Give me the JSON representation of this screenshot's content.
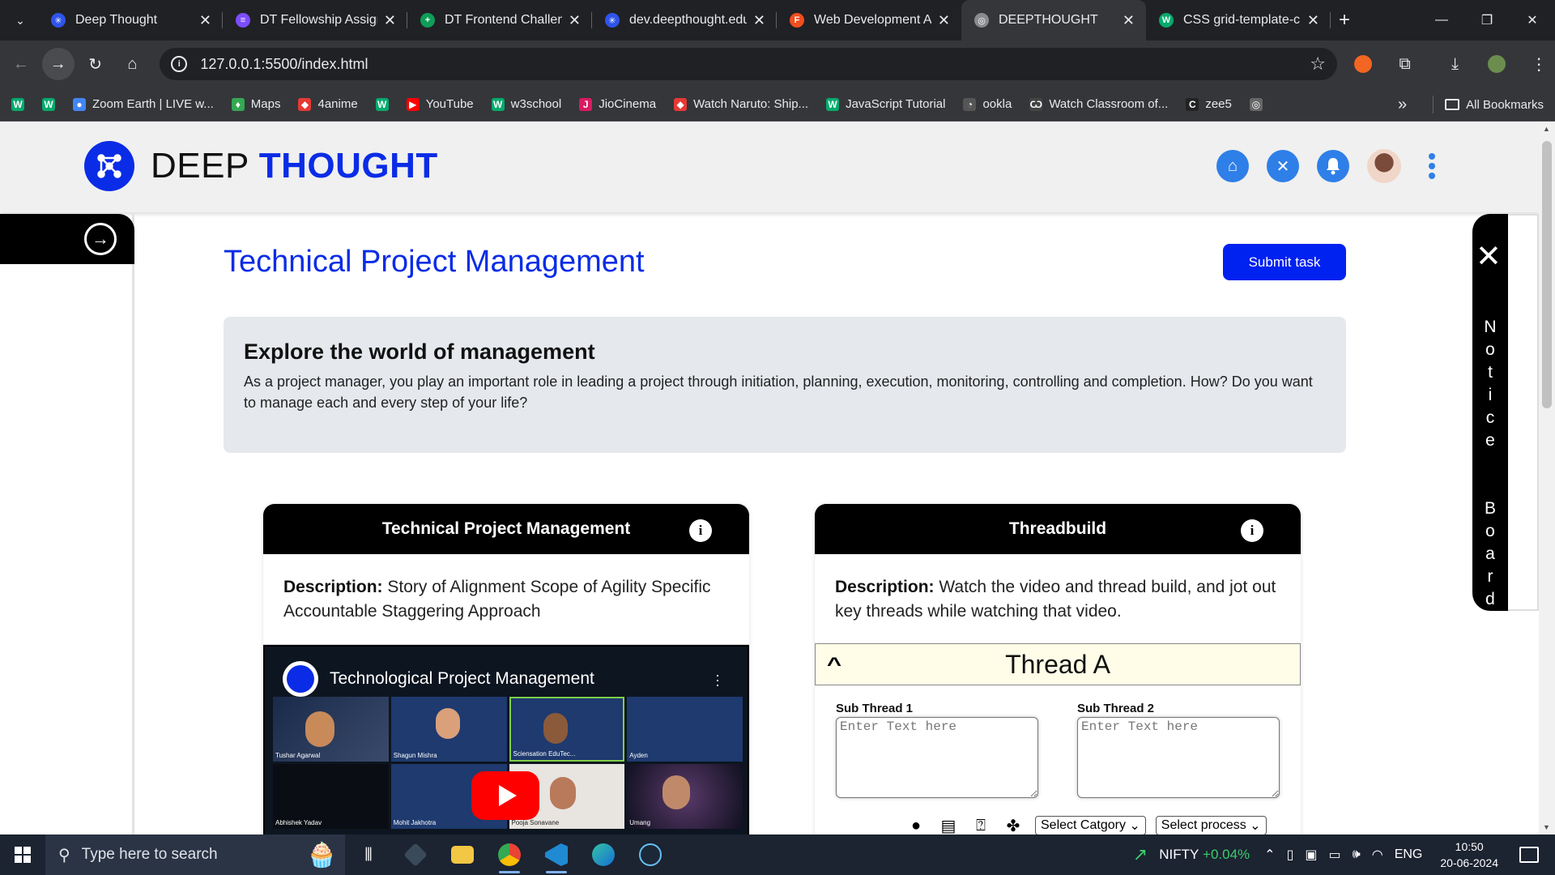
{
  "browser": {
    "tabs": [
      {
        "title": "Deep Thought",
        "color": "#2f54eb",
        "glyph": "✳"
      },
      {
        "title": "DT Fellowship Assign",
        "color": "#7c4dff",
        "glyph": "≡"
      },
      {
        "title": "DT Frontend Challeng",
        "color": "#0f9d58",
        "glyph": "+"
      },
      {
        "title": "dev.deepthought.edu",
        "color": "#2f54eb",
        "glyph": "✳"
      },
      {
        "title": "Web Development A",
        "color": "#f24e1e",
        "glyph": "F"
      },
      {
        "title": "DEEPTHOUGHT",
        "color": "#8a8b8e",
        "glyph": "◎"
      },
      {
        "title": "CSS grid-template-c",
        "color": "#04aa6d",
        "glyph": "W"
      }
    ],
    "active_tab": 5,
    "url": "127.0.0.1:5500/index.html",
    "bookmarks": [
      {
        "label": "",
        "color": "#04aa6d",
        "glyph": "W"
      },
      {
        "label": "",
        "color": "#04aa6d",
        "glyph": "W"
      },
      {
        "label": "Zoom Earth | LIVE w...",
        "color": "#4285f4",
        "glyph": "●"
      },
      {
        "label": "Maps",
        "color": "#34a853",
        "glyph": "♦"
      },
      {
        "label": "4anime",
        "color": "#e53935",
        "glyph": "◆"
      },
      {
        "label": "",
        "color": "#04aa6d",
        "glyph": "W"
      },
      {
        "label": "YouTube",
        "color": "#ff0000",
        "glyph": "▶"
      },
      {
        "label": "w3school",
        "color": "#04aa6d",
        "glyph": "W"
      },
      {
        "label": "JioCinema",
        "color": "#d81b60",
        "glyph": "J"
      },
      {
        "label": "Watch Naruto: Ship...",
        "color": "#e53935",
        "glyph": "◆"
      },
      {
        "label": "JavaScript Tutorial",
        "color": "#04aa6d",
        "glyph": "W"
      },
      {
        "label": "ookla",
        "color": "#555",
        "glyph": "◔"
      },
      {
        "label": "Watch Classroom of...",
        "color": "#444",
        "glyph": "Ѡ"
      },
      {
        "label": "zee5",
        "color": "#222",
        "glyph": "C"
      },
      {
        "label": "",
        "color": "#666",
        "glyph": "◎"
      }
    ],
    "all_bookmarks": "All Bookmarks"
  },
  "site": {
    "brand_light": "DEEP ",
    "brand_bold": "THOUGHT",
    "title": "Technical Project Management",
    "submit_label": "Submit task",
    "explore": {
      "heading": "Explore the world of management",
      "body": "As a project manager, you play an important role in leading a project through initiation, planning, execution, monitoring, controlling and completion. How? Do you want to manage each and every step of your life?"
    },
    "card1": {
      "header": "Technical Project Management",
      "desc_label": "Description:",
      "desc_text": " Story of Alignment Scope of Agility Specific Accountable Staggering Approach",
      "video_title": "Technological Project Management",
      "participants": [
        "Tushar Agarwal",
        "Shagun Mishra",
        "Sciensation EduTec...",
        "Ayden",
        "Abhishek Yadav",
        "Mohit Jakhotra",
        "Pooja Sonavane",
        "Umang"
      ]
    },
    "card2": {
      "header": "Threadbuild",
      "desc_label": "Description:",
      "desc_text": " Watch the video and thread build, and jot out key threads while watching that video.",
      "thread_name": "Thread A",
      "sub1_label": "Sub Thread 1",
      "sub2_label": "Sub Thread 2",
      "placeholder": "Enter Text here",
      "category_select": "Select Catgory",
      "process_select": "Select process"
    },
    "notice_board": "Notice Board"
  },
  "taskbar": {
    "search_placeholder": "Type here to search",
    "nifty_label": "NIFTY",
    "nifty_change": "+0.04%",
    "lang": "ENG",
    "time": "10:50",
    "date": "20-06-2024"
  }
}
